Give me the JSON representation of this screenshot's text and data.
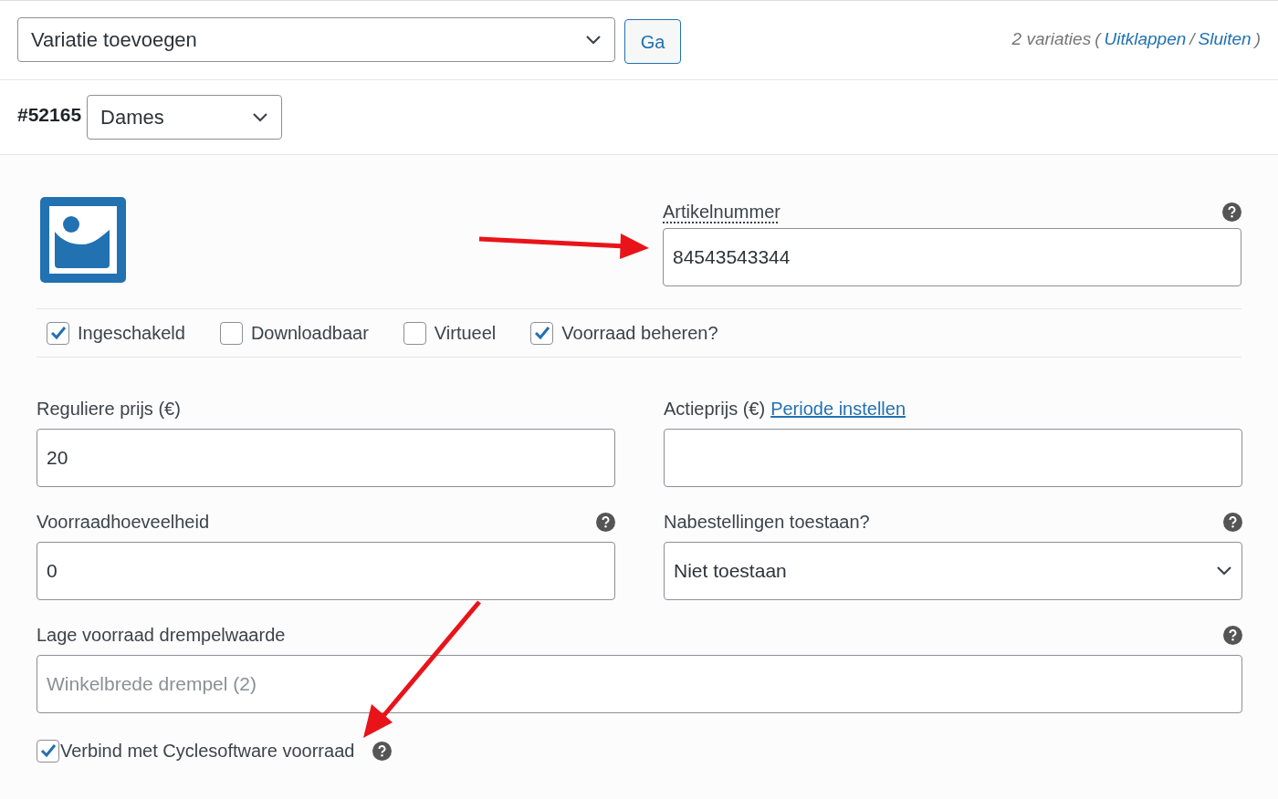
{
  "toolbar": {
    "select": "Variatie toevoegen",
    "button": "Ga",
    "count": "2 variaties",
    "open_paren": "(",
    "expand_link": "Uitklappen",
    "separator": "/",
    "close_link": "Sluiten",
    "close_paren": ")"
  },
  "variation": {
    "id": "#52165",
    "attribute": "Dames"
  },
  "sku": {
    "label": "Artikelnummer",
    "value": "84543543344",
    "help": true
  },
  "options": [
    {
      "label": "Ingeschakeld",
      "checked": true
    },
    {
      "label": "Downloadbaar",
      "checked": false
    },
    {
      "label": "Virtueel",
      "checked": false
    },
    {
      "label": "Voorraad beheren?",
      "checked": true
    }
  ],
  "fields": [
    {
      "kind": "input",
      "label": "Reguliere prijs (€)",
      "value": "20",
      "help": false
    },
    {
      "kind": "input",
      "label": "Actieprijs (€)",
      "link": "Periode instellen",
      "help": false
    },
    {
      "kind": "input",
      "label": "Voorraadhoeveelheid",
      "value": "0",
      "help": true
    },
    {
      "kind": "select",
      "label": "Nabestellingen toestaan?",
      "value": "Niet toestaan",
      "help": true
    },
    {
      "kind": "wide",
      "label": "Lage voorraad drempelwaarde",
      "placeholder": "Winkelbrede drempel (2)",
      "help": true
    }
  ],
  "sync": {
    "label": "Verbind met Cyclesoftware voorraad",
    "checked": true,
    "help": true
  },
  "annotations": [
    {
      "kind": "arrow"
    },
    {
      "kind": "arrow"
    }
  ]
}
